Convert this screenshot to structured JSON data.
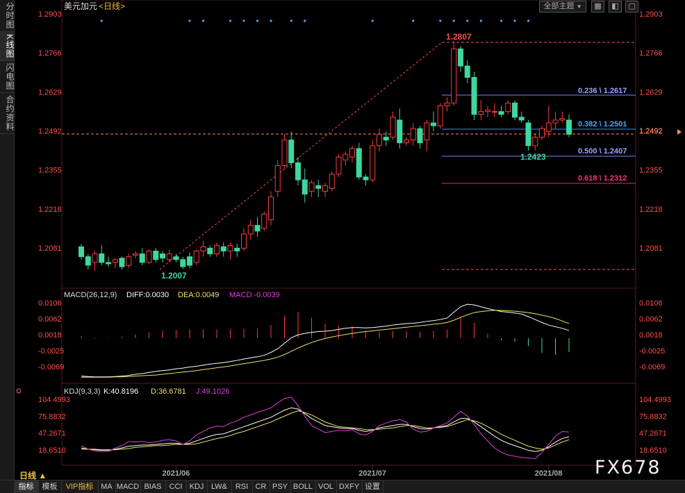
{
  "sidebar": {
    "tabs": [
      {
        "label": "分时图",
        "active": false
      },
      {
        "label": "K线图",
        "active": true
      },
      {
        "label": "闪电图",
        "active": false
      },
      {
        "label": "合约资料",
        "active": false
      }
    ]
  },
  "header": {
    "symbol": "美元加元",
    "period": "<日线>",
    "topic_button": "全部主题",
    "dropdown_icon": "chevron-down-icon",
    "icons": [
      "grid-icon",
      "split-window-icon",
      "window-icon"
    ]
  },
  "price_axis": {
    "labels": [
      "1.2903",
      "1.2766",
      "1.2629",
      "1.2492",
      "1.2355",
      "1.2218",
      "1.2081"
    ]
  },
  "annotations": {
    "high_label": "1.2807",
    "low_label": "1.2007",
    "swing_low_label": "1.2423",
    "fib": [
      {
        "label": "0.236 \\ 1.2617",
        "color": "#9aa6ff"
      },
      {
        "label": "0.382 \\ 1.2501",
        "color": "#4aa8ff"
      },
      {
        "label": "0.500 \\ 1.2407",
        "color": "#9aa6ff"
      },
      {
        "label": "0.618 \\ 1.2312",
        "color": "#ff3377"
      }
    ]
  },
  "macd": {
    "title": "MACD(26,12,9)",
    "diff": "DIFF:0.0030",
    "dea": "DEA:0.0049",
    "macd": "MACD:-0.0039",
    "axis_labels": [
      "0.0106",
      "0.0062",
      "0.0018",
      "-0.0025",
      "-0.0069"
    ]
  },
  "kdj": {
    "title": "KDJ(9,3,3)",
    "k": "K:40.8196",
    "d": "D:36.6781",
    "j": "J:49.1026",
    "axis_labels": [
      "104.4993",
      "75.8832",
      "47.2671",
      "18.6510"
    ],
    "settings_icon": "gear-icon"
  },
  "time_axis": [
    "2021/06",
    "2021/07",
    "2021/08"
  ],
  "bottom_tabs": [
    {
      "label": "指标",
      "active": true
    },
    {
      "label": "模板"
    },
    {
      "label": "VIP指标",
      "vip": true
    },
    {
      "label": "MA"
    },
    {
      "label": "MACD"
    },
    {
      "label": "BIAS"
    },
    {
      "label": "CCI"
    },
    {
      "label": "KDJ"
    },
    {
      "label": "LW&"
    },
    {
      "label": "RSI"
    },
    {
      "label": "CR"
    },
    {
      "label": "PSY"
    },
    {
      "label": "BOLL"
    },
    {
      "label": "VOL"
    },
    {
      "label": "DXFY"
    },
    {
      "label": "设置"
    }
  ],
  "period_tag": "日线 ▲",
  "watermark": "FX678",
  "colors": {
    "up": "#ff3b3b",
    "down": "#3fd6a0",
    "dif": "#ffffff",
    "dea": "#f0e36a",
    "j": "#e040e0",
    "axis": "#ff4d4d"
  },
  "chart_data": {
    "type": "candlestick",
    "price_range": [
      1.195,
      1.2903
    ],
    "candles": [
      [
        1.2085,
        1.2095,
        1.204,
        1.205
      ],
      [
        1.205,
        1.206,
        1.2005,
        1.202
      ],
      [
        1.203,
        1.207,
        1.2,
        1.206
      ],
      [
        1.206,
        1.209,
        1.202,
        1.203
      ],
      [
        1.203,
        1.205,
        1.2015,
        1.2025
      ],
      [
        1.203,
        1.2045,
        1.201,
        1.204
      ],
      [
        1.2045,
        1.205,
        1.2005,
        1.2015
      ],
      [
        1.202,
        1.206,
        1.201,
        1.205
      ],
      [
        1.2055,
        1.207,
        1.2045,
        1.206
      ],
      [
        1.206,
        1.208,
        1.202,
        1.203
      ],
      [
        1.203,
        1.2075,
        1.2025,
        1.207
      ],
      [
        1.207,
        1.208,
        1.203,
        1.204
      ],
      [
        1.206,
        1.207,
        1.203,
        1.2045
      ],
      [
        1.204,
        1.2075,
        1.203,
        1.206
      ],
      [
        1.205,
        1.206,
        1.203,
        1.204
      ],
      [
        1.204,
        1.205,
        1.2007,
        1.2015
      ],
      [
        1.205,
        1.2065,
        1.201,
        1.202
      ],
      [
        1.203,
        1.2075,
        1.202,
        1.207
      ],
      [
        1.207,
        1.2105,
        1.205,
        1.2085
      ],
      [
        1.208,
        1.209,
        1.205,
        1.206
      ],
      [
        1.206,
        1.21,
        1.205,
        1.209
      ],
      [
        1.2085,
        1.21,
        1.205,
        1.207
      ],
      [
        1.207,
        1.21,
        1.204,
        1.209
      ],
      [
        1.208,
        1.2095,
        1.205,
        1.207
      ],
      [
        1.208,
        1.215,
        1.207,
        1.213
      ],
      [
        1.213,
        1.218,
        1.211,
        1.216
      ],
      [
        1.216,
        1.219,
        1.212,
        1.214
      ],
      [
        1.215,
        1.221,
        1.214,
        1.22
      ],
      [
        1.218,
        1.228,
        1.216,
        1.226
      ],
      [
        1.228,
        1.239,
        1.226,
        1.237
      ],
      [
        1.237,
        1.248,
        1.236,
        1.246
      ],
      [
        1.246,
        1.249,
        1.236,
        1.238
      ],
      [
        1.238,
        1.24,
        1.23,
        1.232
      ],
      [
        1.232,
        1.236,
        1.224,
        1.227
      ],
      [
        1.228,
        1.232,
        1.226,
        1.231
      ],
      [
        1.23,
        1.232,
        1.226,
        1.229
      ],
      [
        1.228,
        1.231,
        1.226,
        1.23
      ],
      [
        1.229,
        1.235,
        1.228,
        1.234
      ],
      [
        1.234,
        1.241,
        1.233,
        1.24
      ],
      [
        1.239,
        1.242,
        1.237,
        1.241
      ],
      [
        1.24,
        1.244,
        1.238,
        1.243
      ],
      [
        1.243,
        1.245,
        1.232,
        1.233
      ],
      [
        1.233,
        1.234,
        1.23,
        1.232
      ],
      [
        1.232,
        1.246,
        1.231,
        1.244
      ],
      [
        1.244,
        1.25,
        1.242,
        1.248
      ],
      [
        1.247,
        1.249,
        1.244,
        1.246
      ],
      [
        1.247,
        1.256,
        1.246,
        1.254
      ],
      [
        1.253,
        1.257,
        1.243,
        1.245
      ],
      [
        1.245,
        1.247,
        1.244,
        1.246
      ],
      [
        1.246,
        1.252,
        1.244,
        1.25
      ],
      [
        1.25,
        1.251,
        1.243,
        1.245
      ],
      [
        1.246,
        1.253,
        1.242,
        1.252
      ],
      [
        1.252,
        1.256,
        1.249,
        1.251
      ],
      [
        1.251,
        1.259,
        1.25,
        1.258
      ],
      [
        1.258,
        1.261,
        1.256,
        1.259
      ],
      [
        1.259,
        1.2807,
        1.258,
        1.278
      ],
      [
        1.278,
        1.279,
        1.27,
        1.272
      ],
      [
        1.272,
        1.274,
        1.266,
        1.268
      ],
      [
        1.268,
        1.27,
        1.253,
        1.255
      ],
      [
        1.255,
        1.26,
        1.253,
        1.256
      ],
      [
        1.256,
        1.258,
        1.254,
        1.2565
      ],
      [
        1.256,
        1.259,
        1.254,
        1.256
      ],
      [
        1.256,
        1.258,
        1.254,
        1.255
      ],
      [
        1.256,
        1.26,
        1.255,
        1.259
      ],
      [
        1.259,
        1.26,
        1.253,
        1.254
      ],
      [
        1.254,
        1.256,
        1.252,
        1.253
      ],
      [
        1.252,
        1.253,
        1.2423,
        1.244
      ],
      [
        1.244,
        1.248,
        1.2423,
        1.247
      ],
      [
        1.247,
        1.251,
        1.246,
        1.25
      ],
      [
        1.249,
        1.258,
        1.247,
        1.252
      ],
      [
        1.252,
        1.256,
        1.25,
        1.253
      ],
      [
        1.253,
        1.256,
        1.252,
        1.2535
      ],
      [
        1.253,
        1.255,
        1.247,
        1.248
      ]
    ],
    "macd_range": [
      -0.01,
      0.012
    ],
    "macd_dif": [
      -0.0095,
      -0.0096,
      -0.0097,
      -0.0097,
      -0.0097,
      -0.0096,
      -0.0095,
      -0.0093,
      -0.009,
      -0.0088,
      -0.0085,
      -0.0082,
      -0.008,
      -0.0078,
      -0.0075,
      -0.0073,
      -0.007,
      -0.0068,
      -0.0065,
      -0.0062,
      -0.006,
      -0.0058,
      -0.0055,
      -0.0052,
      -0.0048,
      -0.0045,
      -0.0042,
      -0.0038,
      -0.003,
      -0.002,
      -0.0005,
      0.001,
      0.0018,
      0.0022,
      0.0025,
      0.0027,
      0.0028,
      0.003,
      0.0033,
      0.0036,
      0.0038,
      0.0038,
      0.0037,
      0.0038,
      0.004,
      0.0042,
      0.0045,
      0.0047,
      0.0049,
      0.005,
      0.0052,
      0.0055,
      0.0057,
      0.006,
      0.0064,
      0.008,
      0.0095,
      0.0102,
      0.01,
      0.0095,
      0.009,
      0.0086,
      0.0082,
      0.008,
      0.0078,
      0.0075,
      0.0068,
      0.006,
      0.0052,
      0.0045,
      0.004,
      0.0036,
      0.003
    ],
    "macd_dea": [
      -0.0098,
      -0.0098,
      -0.0098,
      -0.0098,
      -0.0098,
      -0.0097,
      -0.0097,
      -0.0096,
      -0.0095,
      -0.0094,
      -0.0093,
      -0.0092,
      -0.009,
      -0.0088,
      -0.0086,
      -0.0084,
      -0.0082,
      -0.008,
      -0.0077,
      -0.0075,
      -0.0072,
      -0.007,
      -0.0067,
      -0.0064,
      -0.0061,
      -0.0058,
      -0.0055,
      -0.0052,
      -0.0048,
      -0.0043,
      -0.0036,
      -0.0027,
      -0.0018,
      -0.001,
      -0.0003,
      0.0003,
      0.0008,
      0.0012,
      0.0016,
      0.0019,
      0.0022,
      0.0025,
      0.0027,
      0.0029,
      0.0031,
      0.0033,
      0.0035,
      0.0037,
      0.0039,
      0.0041,
      0.0043,
      0.0045,
      0.0047,
      0.0049,
      0.0052,
      0.0058,
      0.0066,
      0.0073,
      0.0079,
      0.0082,
      0.0084,
      0.0085,
      0.0085,
      0.0084,
      0.0083,
      0.0081,
      0.0079,
      0.0076,
      0.0072,
      0.0068,
      0.0063,
      0.0056,
      0.0049
    ],
    "kdj_range": [
      5,
      110
    ],
    "kdj_k": [
      22,
      20,
      19,
      18,
      18,
      20,
      22,
      25,
      26,
      27,
      27,
      28,
      29,
      30,
      30,
      28,
      30,
      34,
      38,
      42,
      45,
      46,
      50,
      54,
      58,
      62,
      66,
      70,
      74,
      80,
      86,
      90,
      88,
      80,
      72,
      66,
      60,
      58,
      56,
      55,
      55,
      52,
      50,
      52,
      56,
      58,
      60,
      62,
      62,
      58,
      55,
      54,
      56,
      58,
      60,
      66,
      72,
      72,
      66,
      58,
      50,
      42,
      35,
      30,
      26,
      22,
      18,
      16,
      18,
      24,
      32,
      38,
      41
    ],
    "kdj_d": [
      20,
      20,
      20,
      19,
      19,
      19,
      20,
      21,
      23,
      24,
      25,
      26,
      26,
      27,
      28,
      28,
      28,
      29,
      32,
      35,
      38,
      40,
      43,
      47,
      50,
      54,
      58,
      62,
      66,
      71,
      76,
      81,
      85,
      82,
      78,
      72,
      66,
      62,
      58,
      57,
      56,
      55,
      53,
      53,
      54,
      55,
      56,
      58,
      60,
      60,
      58,
      56,
      56,
      57,
      58,
      62,
      66,
      70,
      68,
      64,
      58,
      52,
      45,
      40,
      35,
      30,
      25,
      22,
      20,
      22,
      27,
      32,
      36
    ],
    "kdj_j": [
      26,
      20,
      17,
      16,
      16,
      22,
      26,
      33,
      32,
      33,
      31,
      32,
      35,
      36,
      34,
      28,
      34,
      44,
      50,
      56,
      59,
      58,
      64,
      68,
      74,
      78,
      82,
      86,
      90,
      98,
      106,
      108,
      94,
      76,
      60,
      54,
      48,
      50,
      52,
      51,
      53,
      46,
      44,
      50,
      60,
      64,
      68,
      70,
      66,
      54,
      49,
      50,
      56,
      60,
      64,
      74,
      84,
      76,
      62,
      46,
      34,
      22,
      15,
      10,
      8,
      6,
      5,
      4,
      14,
      28,
      42,
      50,
      49
    ]
  }
}
